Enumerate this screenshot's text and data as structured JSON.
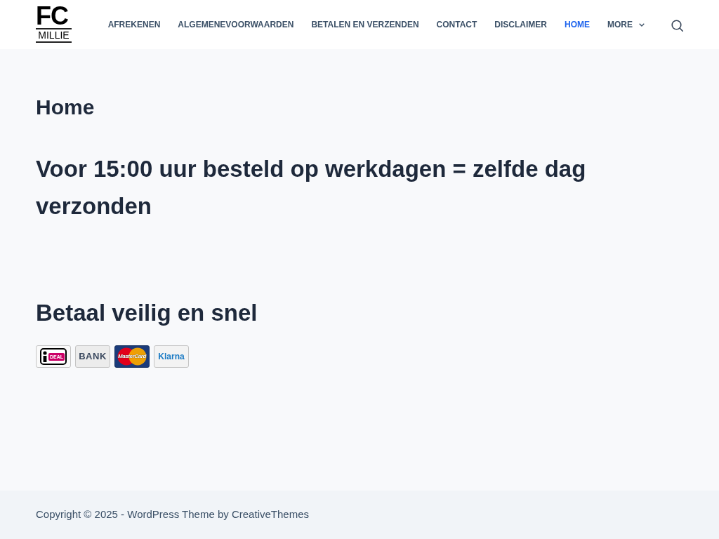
{
  "header": {
    "logo": {
      "top": "FC",
      "bottom": "MILLIE"
    },
    "nav": [
      {
        "label": "AFREKENEN",
        "kind": "link",
        "selected": false
      },
      {
        "label": "ALGEMENEVOORWAARDEN",
        "kind": "link",
        "selected": false
      },
      {
        "label": "BETALEN EN VERZENDEN",
        "kind": "link",
        "selected": false
      },
      {
        "label": "CONTACT",
        "kind": "link",
        "selected": false
      },
      {
        "label": "DISCLAIMER",
        "kind": "link",
        "selected": false
      },
      {
        "label": "HOME",
        "kind": "link",
        "selected": true
      },
      {
        "label": "MORE",
        "kind": "dropdown",
        "selected": false
      }
    ]
  },
  "main": {
    "title": "Home",
    "headline": "Voor 15:00 uur besteld op werkdagen = zelfde dag verzonden",
    "payment": {
      "heading": "Betaal veilig en snel",
      "methods": [
        {
          "kind": "ideal",
          "label": "DEAL"
        },
        {
          "kind": "bank",
          "label": "BANK"
        },
        {
          "kind": "mastercard",
          "label": "MasterCard"
        },
        {
          "kind": "klarna",
          "label": "Klarna"
        }
      ]
    }
  },
  "footer": {
    "text": "Copyright © 2025 - WordPress Theme by CreativeThemes"
  }
}
